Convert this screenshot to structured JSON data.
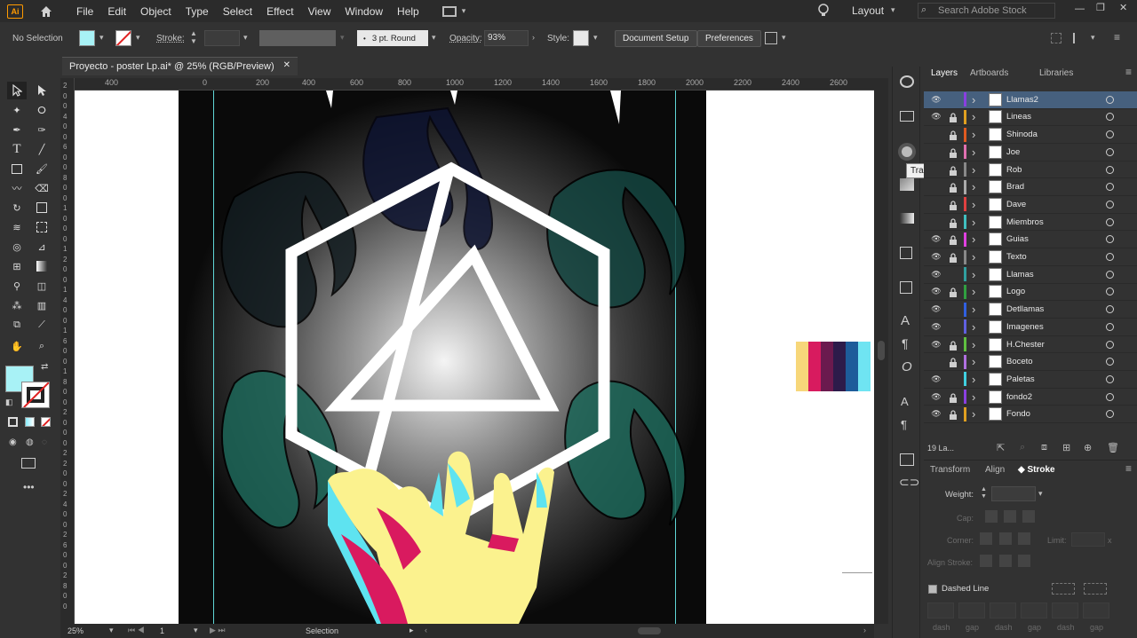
{
  "menubar": {
    "logo": "Ai",
    "items": [
      "File",
      "Edit",
      "Object",
      "Type",
      "Select",
      "Effect",
      "View",
      "Window",
      "Help"
    ],
    "workspace": "Layout",
    "search_placeholder": "Search Adobe Stock"
  },
  "control": {
    "selection_label": "No Selection",
    "stroke_label": "Stroke:",
    "brush": "3 pt. Round",
    "opacity_label": "Opacity:",
    "opacity_value": "93%",
    "style_label": "Style:",
    "document_setup": "Document Setup",
    "preferences": "Preferences"
  },
  "document": {
    "tab_title": "Proyecto - poster Lp.ai* @ 25% (RGB/Preview)",
    "close": "✕"
  },
  "rulers": {
    "h": [
      "400",
      "0",
      "200",
      "400",
      "600",
      "800",
      "1000",
      "1200",
      "1400",
      "1600",
      "1800",
      "2000",
      "2200",
      "2400",
      "2600"
    ],
    "v": [
      "2",
      "0",
      "0",
      "4",
      "0",
      "0",
      "6",
      "0",
      "0",
      "8",
      "0",
      "0",
      "1",
      "0",
      "0",
      "0",
      "1",
      "2",
      "0",
      "0",
      "1",
      "4",
      "0",
      "0",
      "1",
      "6",
      "0",
      "0",
      "1",
      "8",
      "0",
      "0",
      "2",
      "0",
      "0",
      "0",
      "2",
      "2",
      "0",
      "0",
      "2",
      "4",
      "0",
      "0",
      "2",
      "6",
      "0",
      "0",
      "2",
      "8",
      "0",
      "0"
    ]
  },
  "status": {
    "zoom": "25%",
    "artboard": "1",
    "tool": "Selection"
  },
  "tooltip": "Transparency",
  "layers_panel": {
    "tabs": [
      "Layers",
      "Artboards",
      "Libraries"
    ],
    "count": "19 La...",
    "colors": {
      "selected_row": "#46607e"
    },
    "layers": [
      {
        "name": "Llamas2",
        "color": "#8a3fe0",
        "eye": true,
        "lock": false,
        "selected": true
      },
      {
        "name": "Lineas",
        "color": "#e0a020",
        "eye": true,
        "lock": true
      },
      {
        "name": "Shinoda",
        "color": "#e05a20",
        "eye": false,
        "lock": true
      },
      {
        "name": "Joe",
        "color": "#e070b0",
        "eye": false,
        "lock": true
      },
      {
        "name": "Rob",
        "color": "#888888",
        "eye": false,
        "lock": true
      },
      {
        "name": "Brad",
        "color": "#aaaaaa",
        "eye": false,
        "lock": true
      },
      {
        "name": "Dave",
        "color": "#e04040",
        "eye": false,
        "lock": true
      },
      {
        "name": "Miembros",
        "color": "#40c0c0",
        "eye": false,
        "lock": true
      },
      {
        "name": "Guias",
        "color": "#e040e0",
        "eye": true,
        "lock": true
      },
      {
        "name": "Texto",
        "color": "#888888",
        "eye": true,
        "lock": true
      },
      {
        "name": "Llamas",
        "color": "#30a0a0",
        "eye": true,
        "lock": false
      },
      {
        "name": "Logo",
        "color": "#30a040",
        "eye": true,
        "lock": true
      },
      {
        "name": "Detllamas",
        "color": "#3060e0",
        "eye": true,
        "lock": false
      },
      {
        "name": "Imagenes",
        "color": "#6060e0",
        "eye": true,
        "lock": false
      },
      {
        "name": "H.Chester",
        "color": "#60c040",
        "eye": true,
        "lock": true
      },
      {
        "name": "Boceto",
        "color": "#b070e0",
        "eye": false,
        "lock": true
      },
      {
        "name": "Paletas",
        "color": "#40d0e0",
        "eye": true,
        "lock": false
      },
      {
        "name": "fondo2",
        "color": "#8a3fe0",
        "eye": true,
        "lock": true
      },
      {
        "name": "Fondo",
        "color": "#e0a020",
        "eye": true,
        "lock": true
      }
    ]
  },
  "stroke_panel": {
    "tabs": [
      "Transform",
      "Align",
      "Stroke"
    ],
    "weight_label": "Weight:",
    "cap_label": "Cap:",
    "corner_label": "Corner:",
    "limit_label": "Limit:",
    "align_label": "Align Stroke:",
    "dashed_label": "Dashed Line",
    "dash_labels": [
      "dash",
      "gap",
      "dash",
      "gap",
      "dash",
      "gap"
    ]
  },
  "palette": [
    "#f7d77a",
    "#d81b5f",
    "#6b1a4e",
    "#2d1b4a",
    "#1d5c9a",
    "#6fe4f2"
  ]
}
